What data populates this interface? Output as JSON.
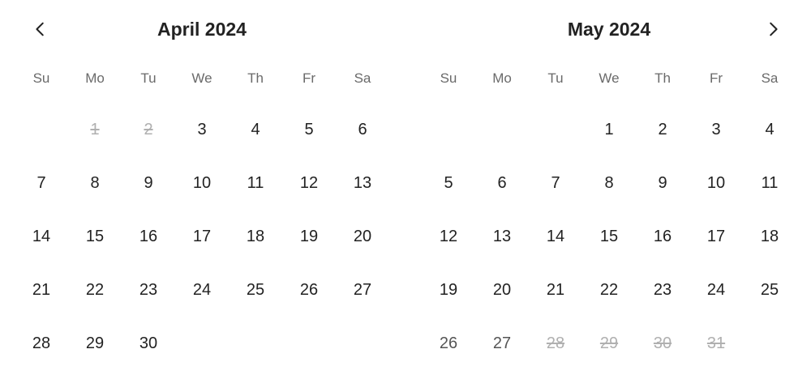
{
  "weekdays": [
    "Su",
    "Mo",
    "Tu",
    "We",
    "Th",
    "Fr",
    "Sa"
  ],
  "months": [
    {
      "title": "April 2024",
      "days": [
        {
          "label": "",
          "state": "empty"
        },
        {
          "label": "1",
          "state": "disabled"
        },
        {
          "label": "2",
          "state": "disabled"
        },
        {
          "label": "3",
          "state": "available"
        },
        {
          "label": "4",
          "state": "available"
        },
        {
          "label": "5",
          "state": "available"
        },
        {
          "label": "6",
          "state": "available"
        },
        {
          "label": "7",
          "state": "available"
        },
        {
          "label": "8",
          "state": "available"
        },
        {
          "label": "9",
          "state": "available"
        },
        {
          "label": "10",
          "state": "available"
        },
        {
          "label": "11",
          "state": "available"
        },
        {
          "label": "12",
          "state": "available"
        },
        {
          "label": "13",
          "state": "available"
        },
        {
          "label": "14",
          "state": "available"
        },
        {
          "label": "15",
          "state": "available"
        },
        {
          "label": "16",
          "state": "available"
        },
        {
          "label": "17",
          "state": "available"
        },
        {
          "label": "18",
          "state": "available"
        },
        {
          "label": "19",
          "state": "available"
        },
        {
          "label": "20",
          "state": "available"
        },
        {
          "label": "21",
          "state": "available"
        },
        {
          "label": "22",
          "state": "available"
        },
        {
          "label": "23",
          "state": "available"
        },
        {
          "label": "24",
          "state": "available"
        },
        {
          "label": "25",
          "state": "available"
        },
        {
          "label": "26",
          "state": "available"
        },
        {
          "label": "27",
          "state": "available"
        },
        {
          "label": "28",
          "state": "available"
        },
        {
          "label": "29",
          "state": "available"
        },
        {
          "label": "30",
          "state": "available"
        }
      ]
    },
    {
      "title": "May 2024",
      "days": [
        {
          "label": "",
          "state": "empty"
        },
        {
          "label": "",
          "state": "empty"
        },
        {
          "label": "",
          "state": "empty"
        },
        {
          "label": "1",
          "state": "available"
        },
        {
          "label": "2",
          "state": "available"
        },
        {
          "label": "3",
          "state": "available"
        },
        {
          "label": "4",
          "state": "available"
        },
        {
          "label": "5",
          "state": "available"
        },
        {
          "label": "6",
          "state": "available"
        },
        {
          "label": "7",
          "state": "available"
        },
        {
          "label": "8",
          "state": "available"
        },
        {
          "label": "9",
          "state": "available"
        },
        {
          "label": "10",
          "state": "available"
        },
        {
          "label": "11",
          "state": "available"
        },
        {
          "label": "12",
          "state": "available"
        },
        {
          "label": "13",
          "state": "available"
        },
        {
          "label": "14",
          "state": "available"
        },
        {
          "label": "15",
          "state": "available"
        },
        {
          "label": "16",
          "state": "available"
        },
        {
          "label": "17",
          "state": "available"
        },
        {
          "label": "18",
          "state": "available"
        },
        {
          "label": "19",
          "state": "available"
        },
        {
          "label": "20",
          "state": "available"
        },
        {
          "label": "21",
          "state": "available"
        },
        {
          "label": "22",
          "state": "available"
        },
        {
          "label": "23",
          "state": "available"
        },
        {
          "label": "24",
          "state": "available"
        },
        {
          "label": "25",
          "state": "available"
        },
        {
          "label": "26",
          "state": "past"
        },
        {
          "label": "27",
          "state": "past"
        },
        {
          "label": "28",
          "state": "disabled"
        },
        {
          "label": "29",
          "state": "disabled"
        },
        {
          "label": "30",
          "state": "disabled"
        },
        {
          "label": "31",
          "state": "disabled"
        }
      ]
    }
  ],
  "nav": {
    "prev_icon": "chevron-left-icon",
    "next_icon": "chevron-right-icon"
  },
  "colors": {
    "text": "#222222",
    "weekday": "#6a6a6a",
    "disabled": "#b0b0b0",
    "background": "#ffffff"
  }
}
